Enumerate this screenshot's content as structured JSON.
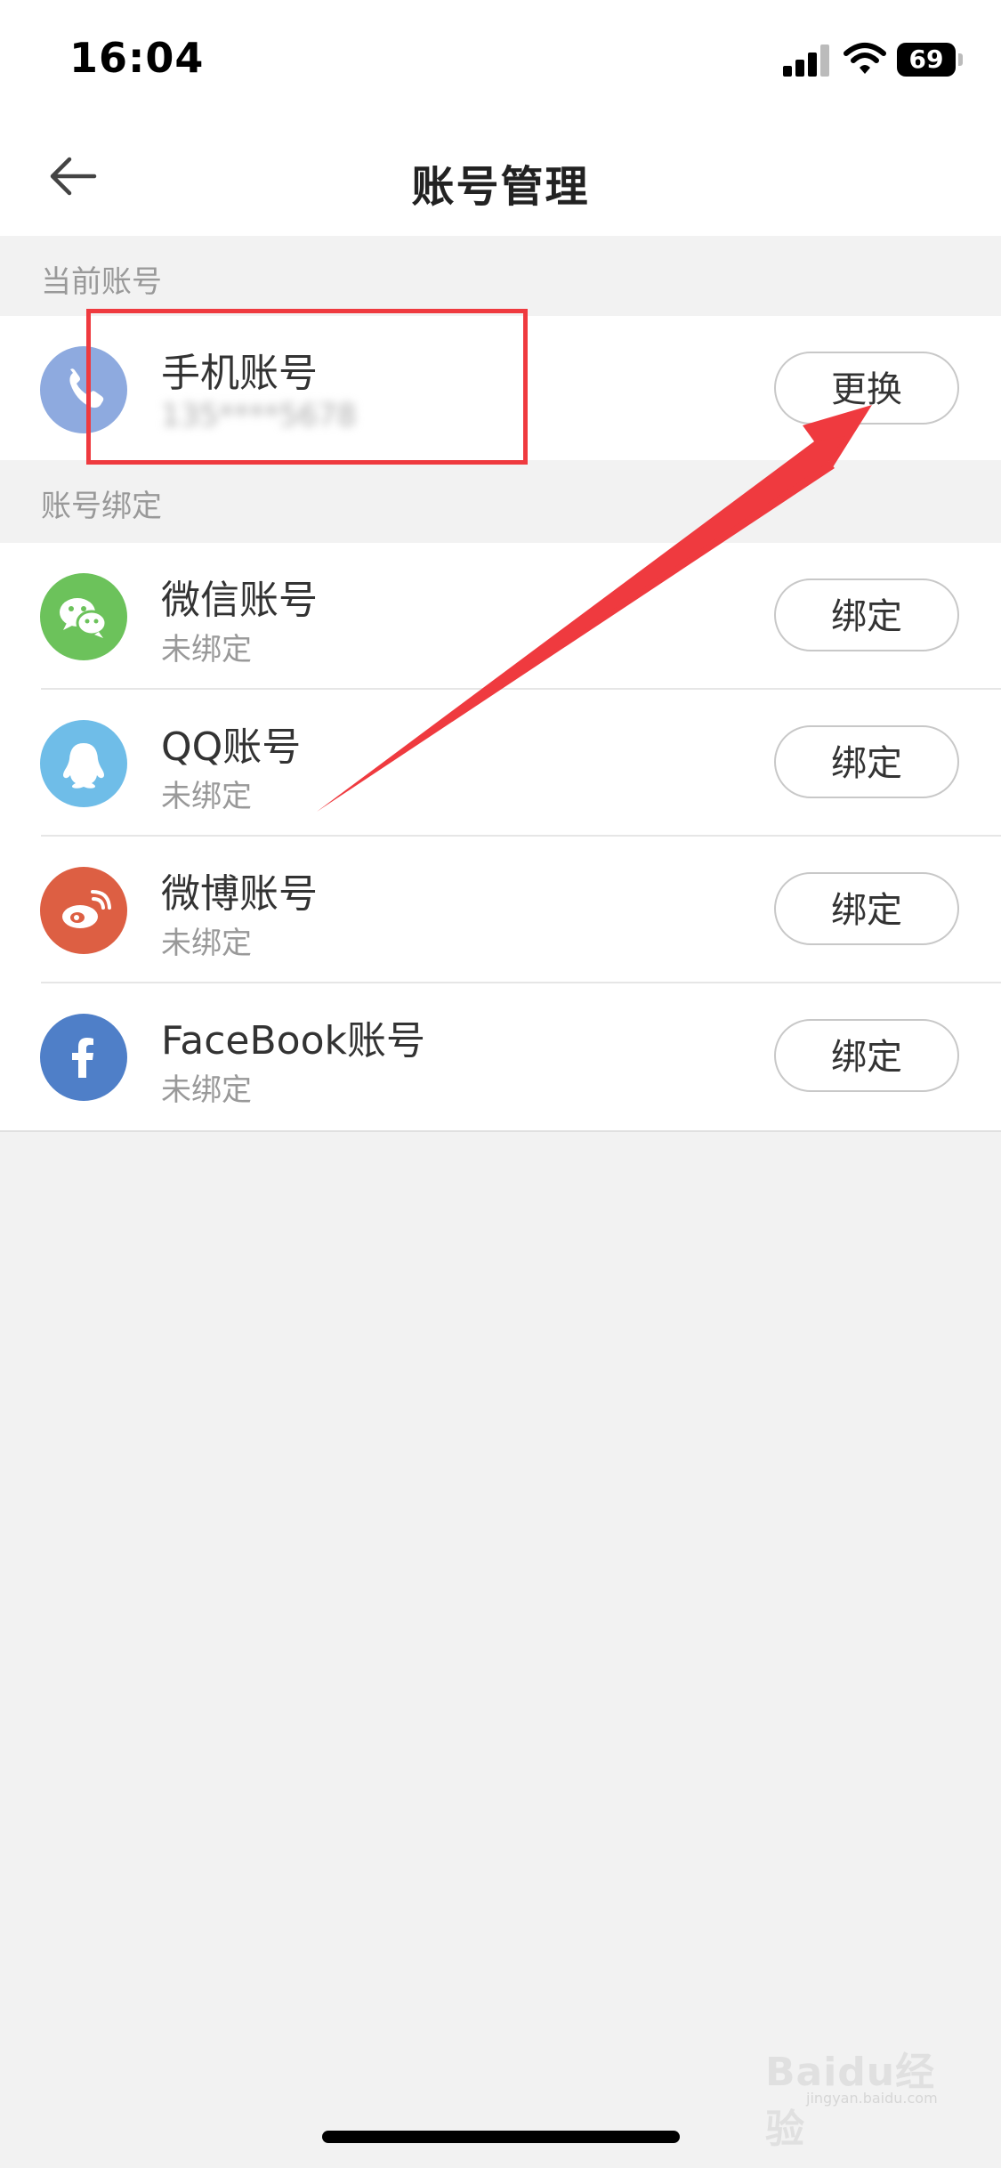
{
  "status_bar": {
    "time": "16:04",
    "battery": "69"
  },
  "nav": {
    "title": "账号管理"
  },
  "sections": {
    "current": "当前账号",
    "binding": "账号绑定"
  },
  "current_account": {
    "icon": "phone-icon",
    "title": "手机账号",
    "value": "135****5678",
    "button": "更换",
    "color": "#8eaadf"
  },
  "bind_accounts": [
    {
      "icon": "wechat-icon",
      "title": "微信账号",
      "status": "未绑定",
      "button": "绑定",
      "color": "#6cc25b"
    },
    {
      "icon": "qq-icon",
      "title": "QQ账号",
      "status": "未绑定",
      "button": "绑定",
      "color": "#6fbde8"
    },
    {
      "icon": "weibo-icon",
      "title": "微博账号",
      "status": "未绑定",
      "button": "绑定",
      "color": "#dd5f43"
    },
    {
      "icon": "facebook-icon",
      "title": "FaceBook账号",
      "status": "未绑定",
      "button": "绑定",
      "color": "#4f7fc8"
    }
  ],
  "annotation": {
    "color": "#ef3a3f"
  },
  "watermark": {
    "text": "Baidu经验",
    "sub": "jingyan.baidu.com"
  }
}
